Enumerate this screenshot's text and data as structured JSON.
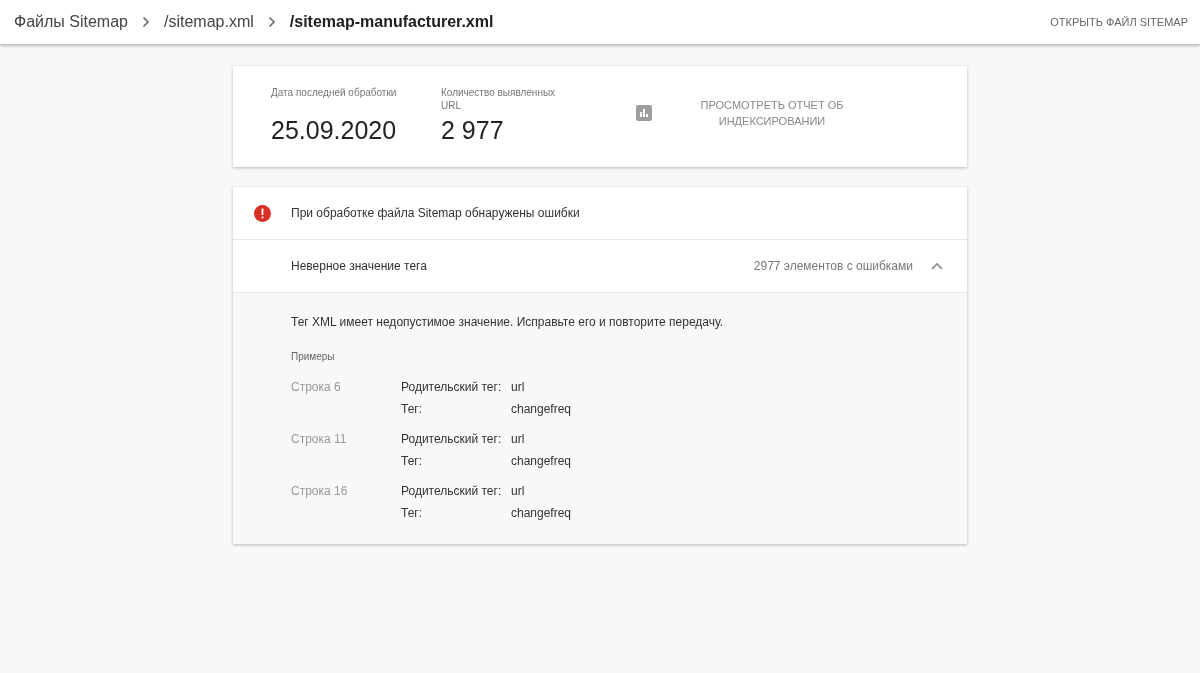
{
  "breadcrumbs": [
    {
      "label": "Файлы Sitemap",
      "current": false
    },
    {
      "label": "/sitemap.xml",
      "current": false
    },
    {
      "label": "/sitemap-manufacturer.xml",
      "current": true
    }
  ],
  "open_button": "ОТКРЫТЬ ФАЙЛ SITEMAP",
  "stats": [
    {
      "label": "Дата последней обработки",
      "value": "25.09.2020"
    },
    {
      "label": "Количество выявленных URL",
      "value": "2 977"
    }
  ],
  "report_button": "ПРОСМОТРЕТЬ ОТЧЕТ ОБ ИНДЕКСИРОВАНИИ",
  "alert": "При обработке файла Sitemap обнаружены ошибки",
  "issue": {
    "title": "Неверное значение тега",
    "count": "2977 элементов с ошибками",
    "expanded": true,
    "description": "Тег XML имеет недопустимое значение. Исправьте его и повторите передачу.",
    "examples_title": "Примеры",
    "examples": [
      {
        "line": "Строка 6",
        "fields": [
          {
            "label": "Родительский тег:",
            "value": "url"
          },
          {
            "label": "Тег:",
            "value": "changefreq"
          }
        ]
      },
      {
        "line": "Строка 11",
        "fields": [
          {
            "label": "Родительский тег:",
            "value": "url"
          },
          {
            "label": "Тег:",
            "value": "changefreq"
          }
        ]
      },
      {
        "line": "Строка 16",
        "fields": [
          {
            "label": "Родительский тег:",
            "value": "url"
          },
          {
            "label": "Тег:",
            "value": "changefreq"
          }
        ]
      }
    ]
  }
}
